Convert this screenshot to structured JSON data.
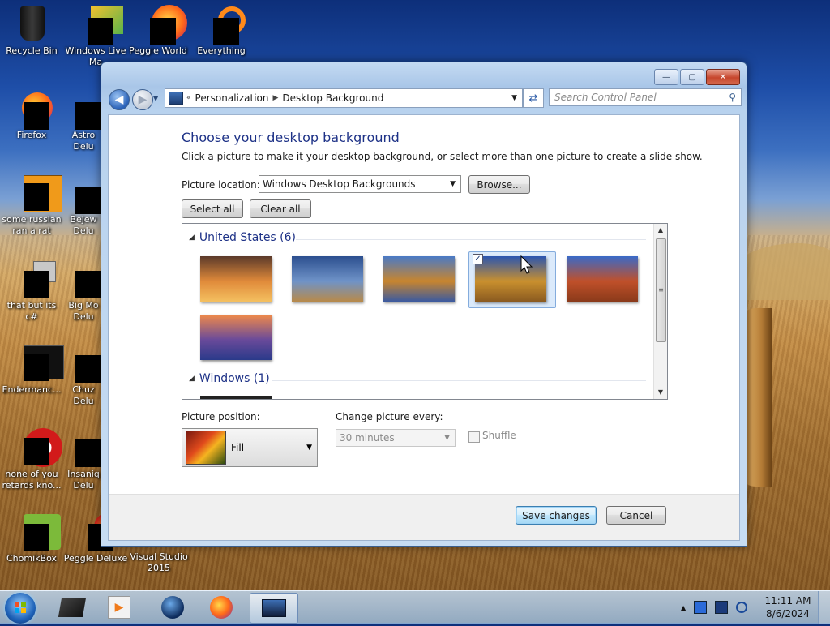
{
  "desktop": {
    "icons": [
      {
        "label": "Recycle Bin"
      },
      {
        "label": "Windows Live Ma"
      },
      {
        "label": "Peggle World"
      },
      {
        "label": "Everything"
      },
      {
        "label": "Firefox"
      },
      {
        "label": "Astro Delu"
      },
      {
        "label": "some russian ran a rat"
      },
      {
        "label": "Bejew Delu"
      },
      {
        "label": "that but its c#"
      },
      {
        "label": "Big Mo Delu"
      },
      {
        "label": "Endermanc..."
      },
      {
        "label": "Chuz Delu"
      },
      {
        "label": "none of you retards kno..."
      },
      {
        "label": "Insaniq Delu"
      },
      {
        "label": "ChomikBox"
      },
      {
        "label": "Peggle Deluxe"
      },
      {
        "label": "Visual Studio 2015"
      }
    ]
  },
  "window": {
    "caption": {
      "minimize": "—",
      "maximize": "▢",
      "close": "✕"
    },
    "breadcrumb": {
      "overflow": "«",
      "items": [
        "Personalization",
        "Desktop Background"
      ]
    },
    "search": {
      "placeholder": "Search Control Panel"
    },
    "title": "Choose your desktop background",
    "subtitle": "Click a picture to make it your desktop background, or select more than one picture to create a slide show.",
    "picture_location": {
      "label": "Picture location:",
      "value": "Windows Desktop Backgrounds",
      "browse": "Browse..."
    },
    "select_all": "Select all",
    "clear_all": "Clear all",
    "groups": [
      {
        "title": "United States (6)",
        "thumbnails": [
          {
            "name": "sunset-valley",
            "colors": [
              "#5b3a2a",
              "#e08a3a",
              "#f4c060"
            ],
            "selected": false
          },
          {
            "name": "lighthouse",
            "colors": [
              "#2c4f8f",
              "#6f93c8",
              "#b88a4a"
            ],
            "selected": false
          },
          {
            "name": "rock-lake",
            "colors": [
              "#4a7ac6",
              "#c8852e",
              "#3b5aa0"
            ],
            "selected": false
          },
          {
            "name": "hay-bale",
            "colors": [
              "#2a55b0",
              "#c9902e",
              "#8a5a20"
            ],
            "selected": true
          },
          {
            "name": "arch",
            "colors": [
              "#3a6ac8",
              "#c0502a",
              "#8a3a1a"
            ],
            "selected": false
          },
          {
            "name": "lupine-lake",
            "colors": [
              "#f08a4a",
              "#6a4a9a",
              "#2a3a8a"
            ],
            "selected": false
          }
        ]
      },
      {
        "title": "Windows (1)",
        "thumbnails": []
      }
    ],
    "picture_position": {
      "label": "Picture position:",
      "value": "Fill"
    },
    "change_every": {
      "label": "Change picture every:",
      "value": "30 minutes"
    },
    "shuffle": {
      "label": "Shuffle",
      "checked": false
    },
    "save": "Save changes",
    "cancel": "Cancel"
  },
  "taskbar": {
    "clock_time": "11:11 AM",
    "clock_date": "8/6/2024",
    "tray_expand": "▲"
  }
}
